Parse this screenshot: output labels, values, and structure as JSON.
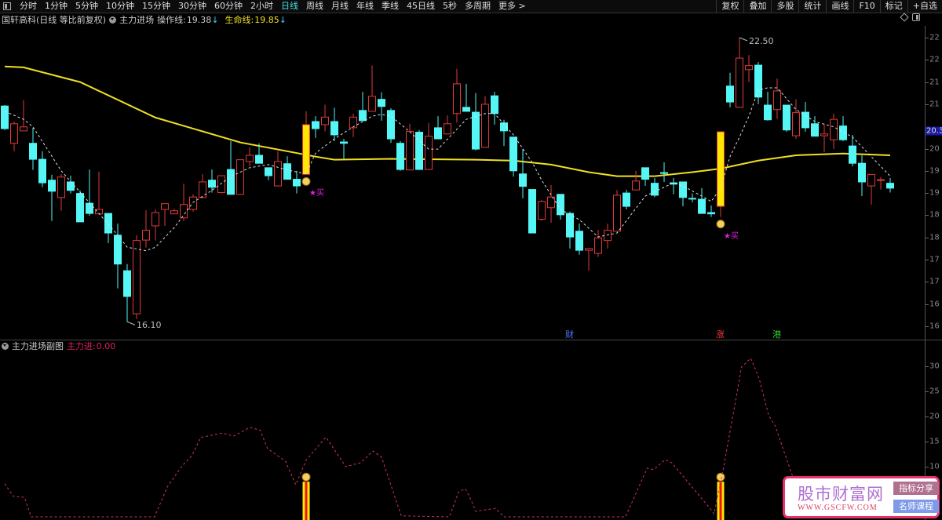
{
  "toolbar": {
    "periods": [
      "分时",
      "1分钟",
      "5分钟",
      "10分钟",
      "15分钟",
      "30分钟",
      "60分钟",
      "2小时",
      "日线",
      "周线",
      "月线",
      "年线",
      "季线",
      "45日线",
      "5秒",
      "多周期",
      "更多 >"
    ],
    "active": "日线",
    "right": [
      "复权",
      "叠加",
      "多股",
      "统计",
      "画线",
      "F10",
      "标记",
      "+自选"
    ]
  },
  "info": {
    "stock": "国轩高科(日线 等比前复权)",
    "indicator": "主力进场",
    "op_label": "操作线:",
    "op_value": "19.38",
    "op_arrow": "↓",
    "life_label": "生命线:",
    "life_value": "19.85",
    "life_arrow": "↓"
  },
  "sub": {
    "title": "主力进场副图",
    "label": "主力进:",
    "value": "0.00"
  },
  "colors": {
    "up": "#e03a3a",
    "down": "#54f6f6",
    "ma": "#f0e020",
    "ops": "#dddddd",
    "sub": "#d0306a",
    "signal": "#ffe800",
    "buy": "#e020e0"
  },
  "main_axis": [
    {
      "value": 22.5,
      "text": "22"
    },
    {
      "value": 22.0,
      "text": "22"
    },
    {
      "value": 21.5,
      "text": "21"
    },
    {
      "value": 21.0,
      "text": "21"
    },
    {
      "value": 20.0,
      "text": "20"
    },
    {
      "value": 19.5,
      "text": "19"
    },
    {
      "value": 19.0,
      "text": "19"
    },
    {
      "value": 18.5,
      "text": "18"
    },
    {
      "value": 18.0,
      "text": "18"
    },
    {
      "value": 17.5,
      "text": "17"
    },
    {
      "value": 17.0,
      "text": "17"
    },
    {
      "value": 16.5,
      "text": "16"
    },
    {
      "value": 16.0,
      "text": "16"
    }
  ],
  "price_marker": {
    "value": 20.4,
    "text": "20.3"
  },
  "sub_axis": [
    {
      "value": 30,
      "text": "30"
    },
    {
      "value": 25,
      "text": "25"
    },
    {
      "value": 20,
      "text": "20"
    },
    {
      "value": 15,
      "text": "15"
    },
    {
      "value": 10,
      "text": "10"
    }
  ],
  "chart_data": {
    "type": "candlestick",
    "ohlc": [
      [
        20.96,
        20.98,
        20.42,
        20.45
      ],
      [
        20.12,
        20.61,
        19.94,
        20.56
      ],
      [
        20.4,
        21.09,
        20.4,
        20.49
      ],
      [
        20.12,
        20.47,
        19.52,
        19.76
      ],
      [
        19.76,
        19.94,
        19.13,
        19.23
      ],
      [
        19.29,
        19.41,
        18.37,
        19.04
      ],
      [
        18.9,
        19.43,
        18.6,
        19.36
      ],
      [
        19.25,
        19.39,
        18.99,
        19.06
      ],
      [
        18.99,
        19.06,
        18.35,
        18.35
      ],
      [
        18.77,
        19.53,
        18.49,
        18.54
      ],
      [
        18.53,
        19.48,
        18.53,
        18.63
      ],
      [
        18.54,
        18.54,
        17.87,
        18.1
      ],
      [
        18.05,
        18.31,
        16.85,
        17.4
      ],
      [
        17.25,
        17.4,
        16.1,
        16.67
      ],
      [
        16.28,
        18.05,
        16.16,
        17.93
      ],
      [
        17.94,
        18.61,
        17.77,
        18.16
      ],
      [
        18.26,
        18.63,
        17.93,
        18.56
      ],
      [
        18.63,
        18.76,
        18.26,
        18.76
      ],
      [
        18.53,
        18.65,
        18.53,
        18.6
      ],
      [
        18.44,
        19.21,
        18.37,
        18.74
      ],
      [
        18.63,
        18.97,
        18.58,
        18.91
      ],
      [
        18.9,
        19.43,
        18.88,
        19.25
      ],
      [
        19.29,
        19.53,
        19.01,
        19.13
      ],
      [
        19.01,
        19.39,
        18.99,
        19.39
      ],
      [
        19.53,
        20.17,
        18.97,
        18.97
      ],
      [
        18.97,
        19.75,
        18.97,
        19.75
      ],
      [
        19.71,
        20.03,
        19.6,
        19.85
      ],
      [
        19.85,
        20.12,
        19.67,
        19.67
      ],
      [
        19.57,
        19.57,
        19.29,
        19.39
      ],
      [
        19.16,
        19.94,
        19.16,
        19.71
      ],
      [
        19.66,
        19.83,
        19.31,
        19.31
      ],
      [
        19.31,
        19.5,
        18.99,
        19.16
      ],
      [
        19.42,
        20.84,
        19.42,
        20.54
      ],
      [
        20.61,
        20.73,
        20.24,
        20.45
      ],
      [
        20.54,
        20.99,
        20.39,
        20.71
      ],
      [
        20.61,
        20.92,
        20.17,
        20.31
      ],
      [
        20.15,
        20.22,
        19.76,
        20.12
      ],
      [
        20.47,
        20.79,
        20.26,
        20.71
      ],
      [
        20.86,
        21.28,
        20.63,
        20.63
      ],
      [
        20.84,
        21.87,
        20.84,
        21.18
      ],
      [
        21.11,
        21.27,
        20.63,
        20.95
      ],
      [
        20.86,
        20.91,
        20.13,
        20.22
      ],
      [
        20.12,
        20.17,
        19.5,
        19.53
      ],
      [
        19.52,
        20.56,
        19.52,
        20.39
      ],
      [
        20.37,
        20.42,
        19.53,
        19.53
      ],
      [
        19.53,
        20.58,
        19.53,
        20.28
      ],
      [
        20.47,
        20.73,
        20.22,
        20.22
      ],
      [
        20.33,
        20.75,
        20.33,
        20.56
      ],
      [
        20.79,
        21.8,
        20.59,
        21.46
      ],
      [
        20.93,
        21.46,
        20.84,
        20.84
      ],
      [
        20.82,
        21.25,
        19.96,
        19.99
      ],
      [
        20.03,
        21.18,
        20.03,
        21.0
      ],
      [
        21.19,
        21.28,
        20.54,
        20.79
      ],
      [
        20.58,
        20.65,
        20.06,
        20.4
      ],
      [
        20.26,
        20.26,
        19.37,
        19.5
      ],
      [
        19.43,
        19.99,
        18.88,
        19.15
      ],
      [
        19.08,
        19.08,
        18.1,
        18.1
      ],
      [
        18.41,
        18.84,
        18.37,
        18.81
      ],
      [
        18.67,
        19.18,
        18.33,
        18.91
      ],
      [
        18.97,
        18.97,
        18.4,
        18.51
      ],
      [
        18.54,
        18.58,
        17.75,
        18.01
      ],
      [
        18.14,
        18.31,
        17.61,
        17.71
      ],
      [
        17.71,
        17.75,
        17.25,
        17.75
      ],
      [
        17.64,
        18.17,
        17.56,
        17.99
      ],
      [
        17.93,
        18.31,
        17.75,
        18.16
      ],
      [
        18.14,
        19.07,
        18.14,
        18.95
      ],
      [
        19.0,
        19.07,
        18.63,
        18.7
      ],
      [
        19.07,
        19.5,
        19.07,
        19.27
      ],
      [
        19.57,
        19.57,
        19.16,
        19.31
      ],
      [
        19.22,
        19.34,
        18.91,
        18.95
      ],
      [
        19.46,
        19.69,
        19.25,
        19.44
      ],
      [
        19.23,
        19.34,
        18.97,
        19.2
      ],
      [
        19.25,
        19.25,
        18.7,
        18.9
      ],
      [
        18.88,
        18.99,
        18.79,
        18.87
      ],
      [
        18.86,
        19.11,
        18.54,
        18.54
      ],
      [
        18.56,
        18.72,
        18.46,
        18.53
      ],
      [
        18.7,
        20.38,
        18.46,
        20.38
      ],
      [
        21.41,
        21.71,
        20.93,
        21.05
      ],
      [
        20.93,
        22.5,
        20.93,
        22.04
      ],
      [
        21.78,
        22.11,
        21.5,
        21.87
      ],
      [
        21.88,
        21.95,
        21.0,
        21.16
      ],
      [
        20.98,
        21.28,
        20.63,
        20.65
      ],
      [
        20.88,
        21.58,
        20.67,
        21.3
      ],
      [
        20.98,
        20.98,
        20.38,
        20.42
      ],
      [
        20.29,
        21.11,
        20.22,
        20.81
      ],
      [
        20.82,
        21.05,
        20.38,
        20.47
      ],
      [
        20.56,
        20.73,
        20.28,
        20.28
      ],
      [
        20.29,
        20.56,
        19.92,
        20.33
      ],
      [
        20.2,
        20.79,
        19.99,
        20.66
      ],
      [
        20.51,
        20.73,
        20.17,
        20.2
      ],
      [
        20.06,
        20.31,
        19.6,
        19.67
      ],
      [
        19.67,
        19.85,
        18.93,
        19.25
      ],
      [
        19.16,
        19.42,
        18.74,
        19.42
      ],
      [
        19.3,
        19.36,
        19.08,
        19.3
      ],
      [
        19.22,
        19.34,
        19.01,
        19.11
      ]
    ],
    "signal_indices": [
      32,
      76
    ],
    "life_line": [
      [
        0,
        21.85
      ],
      [
        2,
        21.83
      ],
      [
        8,
        21.5
      ],
      [
        16,
        20.7
      ],
      [
        25,
        20.14
      ],
      [
        33,
        19.82
      ],
      [
        35,
        19.75
      ],
      [
        41,
        19.77
      ],
      [
        50,
        19.75
      ],
      [
        54,
        19.73
      ],
      [
        58,
        19.64
      ],
      [
        62,
        19.47
      ],
      [
        65,
        19.38
      ],
      [
        69,
        19.38
      ],
      [
        73,
        19.47
      ],
      [
        76,
        19.55
      ],
      [
        80,
        19.73
      ],
      [
        84,
        19.85
      ],
      [
        89,
        19.89
      ],
      [
        94,
        19.85
      ]
    ],
    "operation_line": [
      [
        0,
        20.84
      ],
      [
        2,
        20.66
      ],
      [
        3,
        20.49
      ],
      [
        6,
        19.5
      ],
      [
        8,
        19.02
      ],
      [
        10,
        18.54
      ],
      [
        12,
        18.05
      ],
      [
        13,
        17.78
      ],
      [
        15,
        17.7
      ],
      [
        16,
        17.78
      ],
      [
        18,
        18.22
      ],
      [
        20,
        18.79
      ],
      [
        22,
        19.06
      ],
      [
        24,
        19.37
      ],
      [
        26,
        19.57
      ],
      [
        28,
        19.64
      ],
      [
        30,
        19.52
      ],
      [
        32,
        19.43
      ],
      [
        33,
        19.9
      ],
      [
        35,
        20.22
      ],
      [
        37,
        20.49
      ],
      [
        39,
        20.73
      ],
      [
        40,
        20.77
      ],
      [
        41,
        20.73
      ],
      [
        43,
        20.38
      ],
      [
        45,
        19.99
      ],
      [
        46,
        19.99
      ],
      [
        49,
        20.66
      ],
      [
        51,
        20.79
      ],
      [
        52,
        20.79
      ],
      [
        54,
        20.31
      ],
      [
        56,
        19.69
      ],
      [
        57,
        19.29
      ],
      [
        59,
        18.63
      ],
      [
        61,
        18.4
      ],
      [
        63,
        18.01
      ],
      [
        65,
        18.1
      ],
      [
        68,
        18.93
      ],
      [
        71,
        19.23
      ],
      [
        72,
        19.16
      ],
      [
        74,
        18.93
      ],
      [
        75,
        18.81
      ],
      [
        76,
        19.11
      ],
      [
        77,
        19.82
      ],
      [
        78,
        20.26
      ],
      [
        79,
        20.73
      ],
      [
        80,
        21.32
      ],
      [
        81,
        21.37
      ],
      [
        82,
        21.37
      ],
      [
        84,
        20.88
      ],
      [
        86,
        20.61
      ],
      [
        88,
        20.49
      ],
      [
        90,
        20.26
      ],
      [
        92,
        19.82
      ],
      [
        94,
        19.38
      ]
    ],
    "main_force": [
      [
        0,
        6.6
      ],
      [
        0.9,
        4.1
      ],
      [
        2.1,
        3.9
      ],
      [
        2.8,
        0
      ],
      [
        15.9,
        0
      ],
      [
        17.3,
        6.1
      ],
      [
        18.9,
        10.3
      ],
      [
        19.9,
        12.3
      ],
      [
        20.8,
        15.8
      ],
      [
        23.1,
        16.7
      ],
      [
        24.3,
        16.1
      ],
      [
        26,
        17.8
      ],
      [
        27.1,
        17.3
      ],
      [
        27.9,
        13.6
      ],
      [
        29.8,
        11.1
      ],
      [
        30.9,
        6.4
      ],
      [
        32,
        11.3
      ],
      [
        34.1,
        15.9
      ],
      [
        36.2,
        10.0
      ],
      [
        37.8,
        10.8
      ],
      [
        39.1,
        13.1
      ],
      [
        40,
        11.9
      ],
      [
        42.1,
        0.2
      ],
      [
        47.2,
        0
      ],
      [
        48.2,
        5.0
      ],
      [
        48.9,
        5.6
      ],
      [
        49.5,
        3.4
      ],
      [
        50,
        1.1
      ],
      [
        52.1,
        1.7
      ],
      [
        53,
        0
      ],
      [
        65.9,
        0
      ],
      [
        68.2,
        9.7
      ],
      [
        68.9,
        9.4
      ],
      [
        70.1,
        11.4
      ],
      [
        70.8,
        10.8
      ],
      [
        75,
        1.4
      ],
      [
        75.3,
        0.6
      ],
      [
        76.25,
        9.2
      ],
      [
        77.75,
        24.8
      ],
      [
        78.2,
        29.8
      ],
      [
        79.2,
        31.6
      ],
      [
        80.1,
        27.5
      ],
      [
        81.1,
        20.2
      ],
      [
        81.8,
        18.1
      ],
      [
        83.5,
        8.8
      ],
      [
        84.5,
        4
      ]
    ],
    "signal_bar_value": 7,
    "high_marker": {
      "index": 78,
      "text": "22.50"
    },
    "low_marker": {
      "index": 13,
      "text": "16.10"
    },
    "buy_label": "★买",
    "events": [
      {
        "index": 60,
        "text": "财",
        "color": "#4a7cff"
      },
      {
        "index": 76,
        "text": "涨",
        "color": "#ff3a3a"
      },
      {
        "index": 82,
        "text": "港",
        "color": "#30d030"
      }
    ],
    "ylim": [
      16.0,
      22.6
    ],
    "sub_ylim": [
      0,
      32
    ]
  },
  "watermark": {
    "title": "股市财富网",
    "url": "WWW.GSCFW.COM",
    "badge1": "指标分享",
    "badge2": "名师课程"
  }
}
